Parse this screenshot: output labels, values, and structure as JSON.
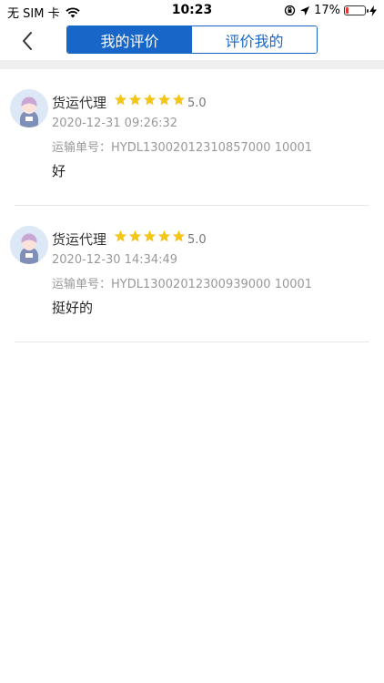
{
  "status_bar": {
    "carrier": "无 SIM 卡",
    "time": "10:23",
    "battery": "17%",
    "battery_level": 0.17
  },
  "nav": {
    "back_icon": "chevron-left-icon",
    "tabs": [
      {
        "label": "我的评价",
        "active": true
      },
      {
        "label": "评价我的",
        "active": false
      }
    ],
    "accent_color": "#1867c8"
  },
  "reviews": [
    {
      "reviewer": "货运代理",
      "rating": 5,
      "score": "5.0",
      "date": "2020-12-31 09:26:32",
      "waybill": "运输单号：HYDL13002012310857000 10001",
      "comment": "好"
    },
    {
      "reviewer": "货运代理",
      "rating": 5,
      "score": "5.0",
      "date": "2020-12-30 14:34:49",
      "waybill": "运输单号：HYDL13002012300939000 10001",
      "comment": "挺好的"
    }
  ],
  "star_color": "#f5c518"
}
